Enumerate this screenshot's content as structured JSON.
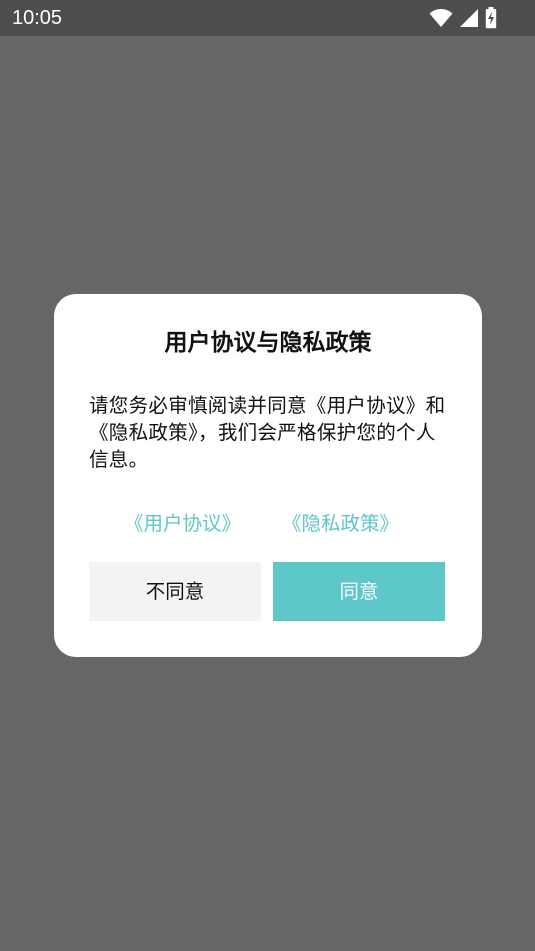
{
  "status_bar": {
    "time": "10:05",
    "icons": [
      "wifi-icon",
      "cellular-signal-icon",
      "battery-charging-icon"
    ]
  },
  "dialog": {
    "title": "用户协议与隐私政策",
    "message": "请您务必审慎阅读并同意《用户协议》和《隐私政策》，我们会严格保护您的个人信息。",
    "links": {
      "user_agreement": "《用户协议》",
      "privacy_policy": "《隐私政策》"
    },
    "buttons": {
      "disagree": "不同意",
      "agree": "同意"
    }
  },
  "colors": {
    "accent": "#5ec7ca",
    "scrim": "#666666",
    "status_bar": "#4d4d4d",
    "disagree_bg": "#f3f3f3"
  }
}
